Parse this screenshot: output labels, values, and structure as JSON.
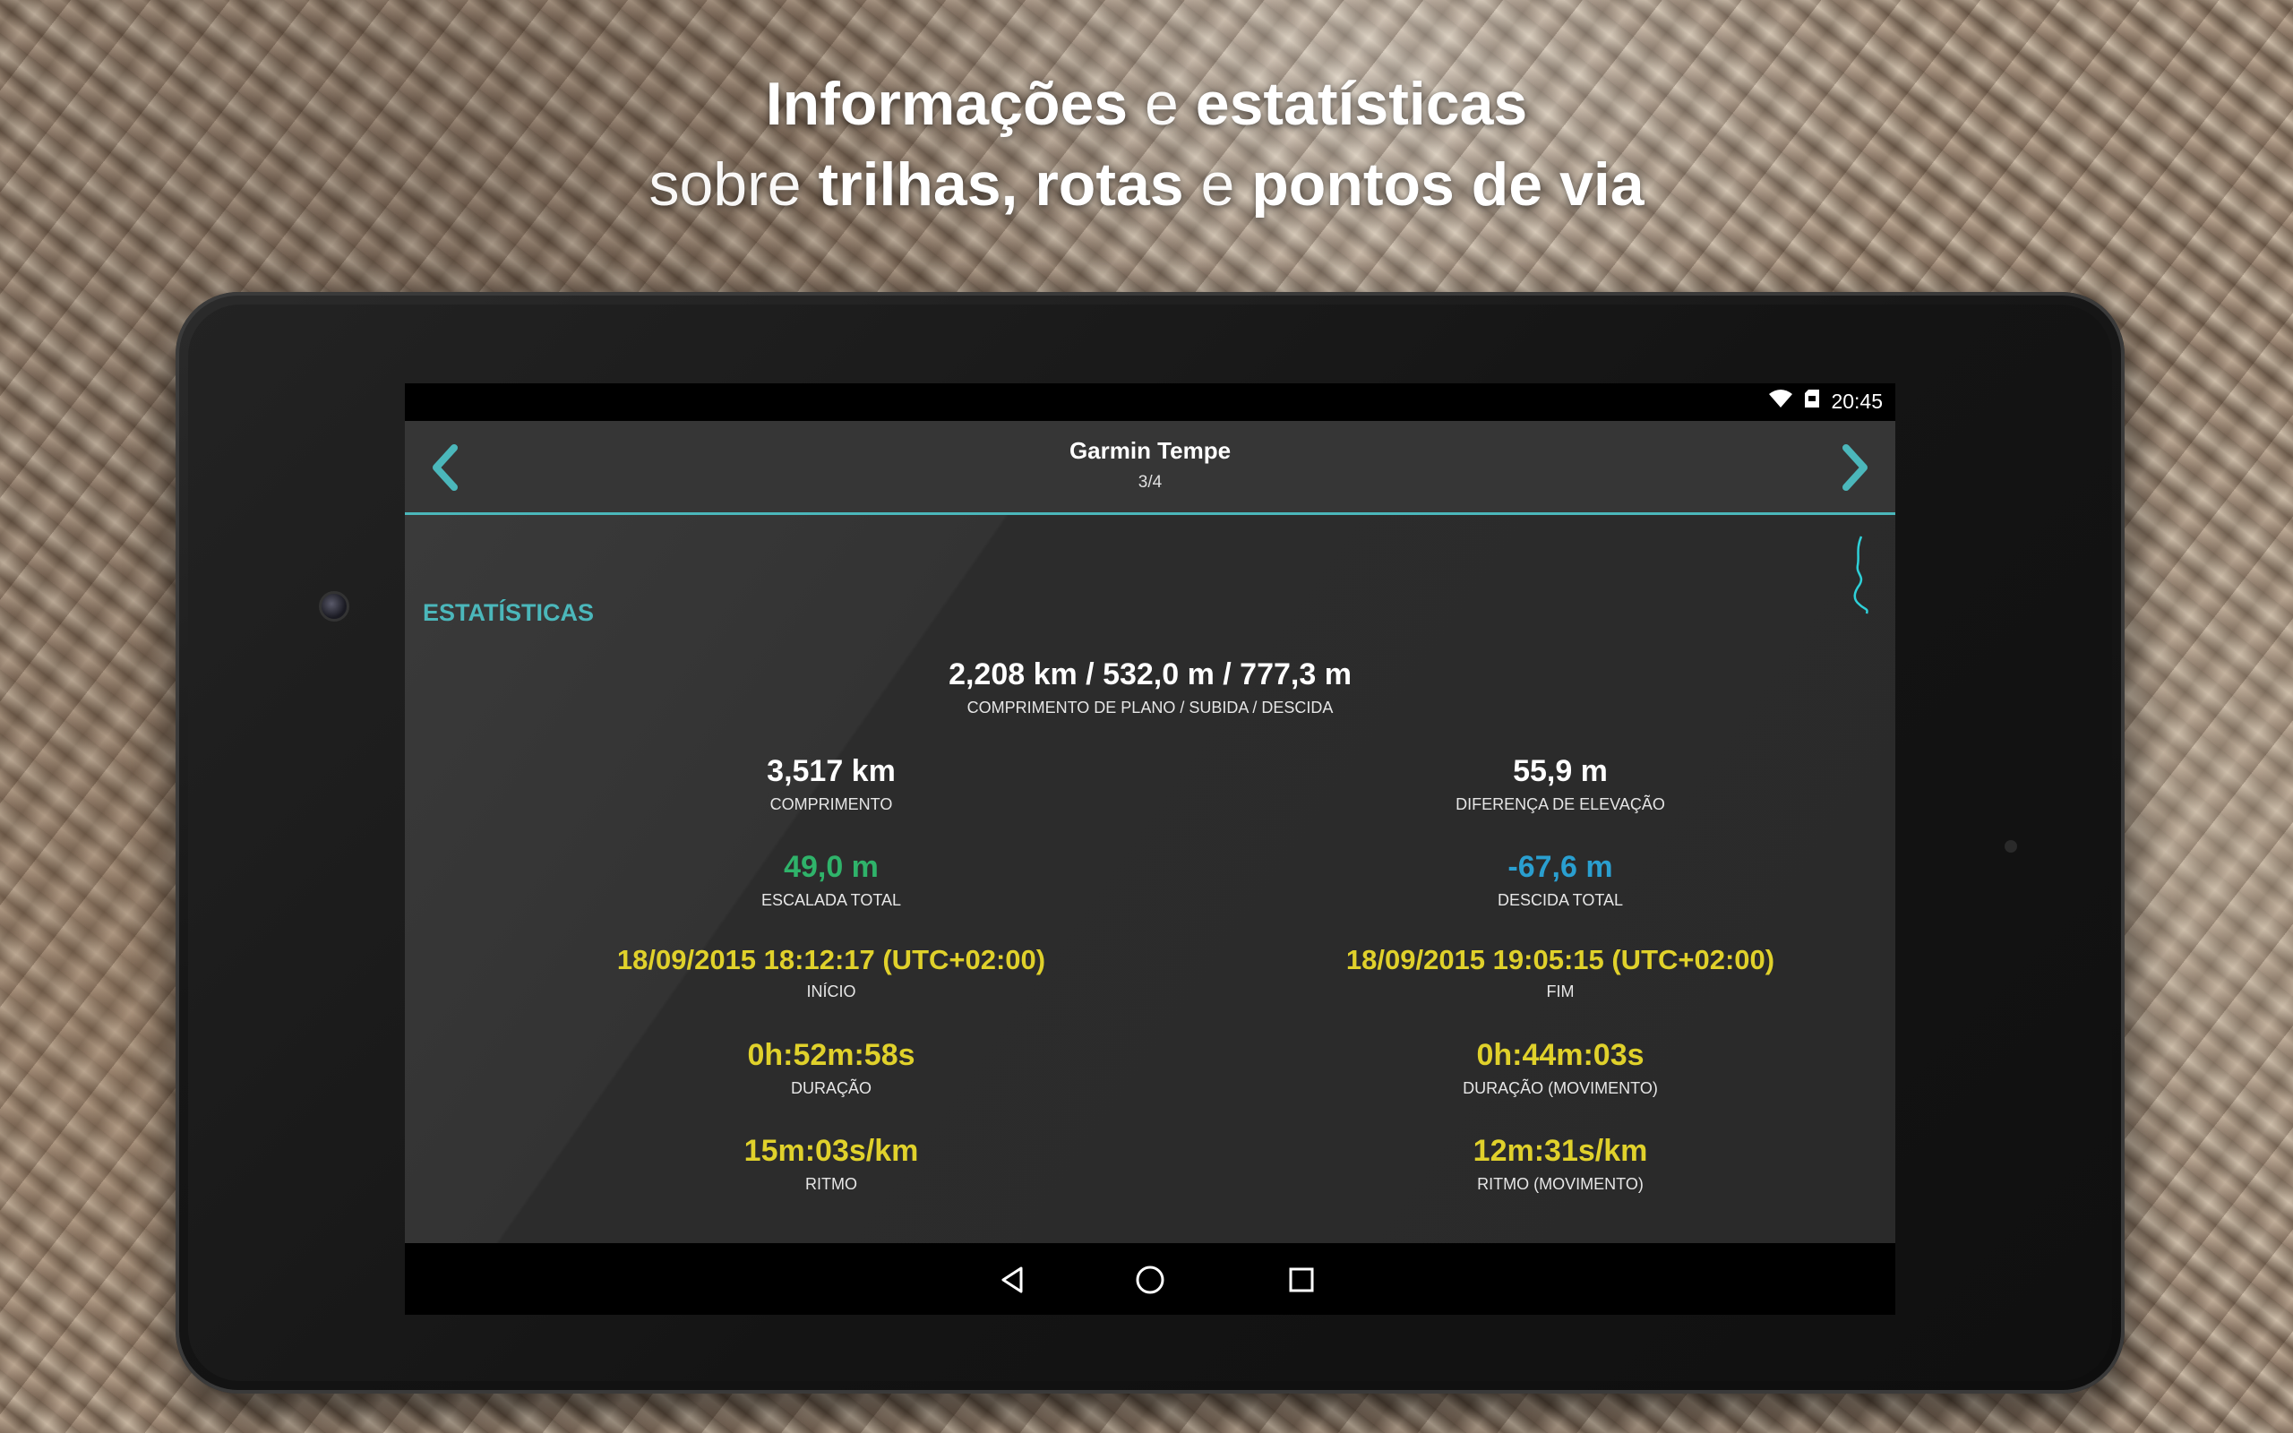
{
  "headline": {
    "line1_a": "Informações",
    "line1_b": "e",
    "line1_c": "estatísticas",
    "line2_a": "sobre",
    "line2_b": "trilhas, rotas",
    "line2_c": "e",
    "line2_d": "pontos de via"
  },
  "status_bar": {
    "time": "20:45",
    "icons": [
      "wifi-icon",
      "sd-card-icon"
    ]
  },
  "app_bar": {
    "title": "Garmin Tempe",
    "subtitle": "3/4",
    "prev_icon": "chevron-left-icon",
    "next_icon": "chevron-right-icon",
    "accent_color": "#4bb7bb"
  },
  "section": {
    "title": "ESTATÍSTICAS"
  },
  "stats": {
    "plan": {
      "value": "2,208 km / 532,0 m / 777,3 m",
      "label": "COMPRIMENTO DE PLANO / SUBIDA / DESCIDA"
    },
    "length": {
      "value": "3,517 km",
      "label": "COMPRIMENTO"
    },
    "elev_diff": {
      "value": "55,9 m",
      "label": "DIFERENÇA DE ELEVAÇÃO"
    },
    "climb": {
      "value": "49,0 m",
      "label": "ESCALADA TOTAL",
      "color": "#2fb36a"
    },
    "descent": {
      "value": "-67,6 m",
      "label": "DESCIDA TOTAL",
      "color": "#2a9fd0"
    },
    "start": {
      "value": "18/09/2015 18:12:17  (UTC+02:00)",
      "label": "INÍCIO",
      "color": "#e0d12b"
    },
    "end": {
      "value": "18/09/2015 19:05:15  (UTC+02:00)",
      "label": "FIM",
      "color": "#e0d12b"
    },
    "duration": {
      "value": "0h:52m:58s",
      "label": "DURAÇÃO",
      "color": "#e0d12b"
    },
    "duration_moving": {
      "value": "0h:44m:03s",
      "label": "DURAÇÃO (MOVIMENTO)",
      "color": "#e0d12b"
    },
    "pace": {
      "value": "15m:03s/km",
      "label": "RITMO",
      "color": "#e0d12b"
    },
    "pace_moving": {
      "value": "12m:31s/km",
      "label": "RITMO (MOVIMENTO)",
      "color": "#e0d12b"
    }
  },
  "nav_bar": {
    "icons": [
      "back-icon",
      "home-icon",
      "recents-icon"
    ]
  }
}
